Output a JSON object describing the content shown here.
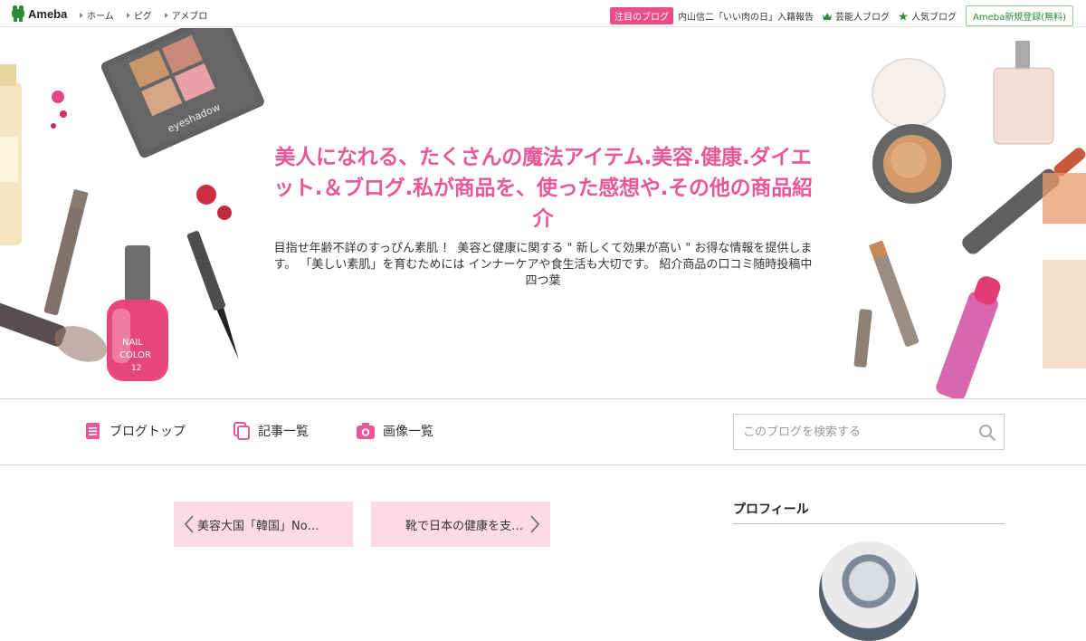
{
  "topbar": {
    "logo_text": "Ameba",
    "nav": [
      "ホーム",
      "ピグ",
      "アメブロ"
    ],
    "featured_badge": "注目のブログ",
    "featured_link": "内山信二「いい肉の日」入籍報告",
    "celebrity_link": "芸能人ブログ",
    "popular_link": "人気ブログ",
    "signup": "Ameba新規登録(無料)"
  },
  "header": {
    "title": "美人になれる、たくさんの魔法アイテム.美容.健康.ダイエット.＆ブログ.私が商品を、使った感想や.その他の商品紹介",
    "description": "目指せ年齢不詳のすっぴん素肌 ！ 美容と健康に関する \" 新しくて効果が高い \" お得な情報を提供します。 「美しい素肌」を育むためには インナーケアや食生活も大切です。 紹介商品の口コミ随時投稿中四つ葉"
  },
  "nav": {
    "blog_top": "ブログトップ",
    "entries": "記事一覧",
    "images": "画像一覧",
    "search_placeholder": "このブログを検索する"
  },
  "pager": {
    "prev": "美容大国「韓国」No…",
    "next": "靴で日本の健康を支…"
  },
  "sidebar": {
    "profile_heading": "プロフィール"
  },
  "colors": {
    "accent_pink": "#e85899",
    "badge_pink": "#e84d86",
    "pager_bg": "#fcdbe4",
    "ameba_green": "#2d8c3c"
  },
  "deco_text": {
    "eyeshadow": "eyeshadow",
    "nail_color": "NAIL",
    "nail_color2": "COLOR",
    "nail_number": "12"
  }
}
